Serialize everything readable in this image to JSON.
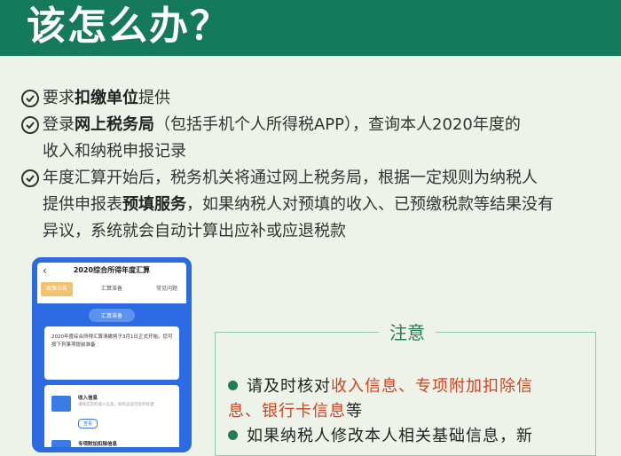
{
  "header": {
    "title": "该怎么办？",
    "bg_color": "#157a5a"
  },
  "items": [
    {
      "pre": "要求",
      "bold": "扣缴单位",
      "post": "提供"
    },
    {
      "pre": "登录",
      "bold": "网上税务局",
      "post": "（包括手机个人所得税APP），查询本人2020年度的",
      "line2": "收入和纳税申报记录"
    },
    {
      "line1": "年度汇算开始后，税务机关将通过网上税务局，根据一定规则为纳税人",
      "pre": "提供申报表",
      "bold": "预填服务",
      "post": "，如果纳税人对预填的收入、已预缴税款等结果没有",
      "line3": "异议，系统就会自动计算出应补或应退税款"
    }
  ],
  "phone": {
    "back": "‹",
    "title": "2020综合所得年度汇算",
    "tabs": [
      "政策公告",
      "汇算准备",
      "常见问题"
    ],
    "pill": "汇算准备",
    "card_text": "2020年度综合所得汇算清缴将于3月1日正式开始。您可按下列事项提前准备",
    "sub1": "收入信息",
    "sub1_text": "请核实您的收入信息，如有异议可及时处理",
    "btn": "查看",
    "sub2": "专项附加扣除信息"
  },
  "notice": {
    "title": "注意",
    "line1_pre": "请及时核对",
    "line1_hl": "收入信息、专项附加扣除信",
    "line2_hl": "息、银行卡信息",
    "line2_post": "等",
    "line3": "如果纳税人修改本人相关基础信息，新"
  }
}
